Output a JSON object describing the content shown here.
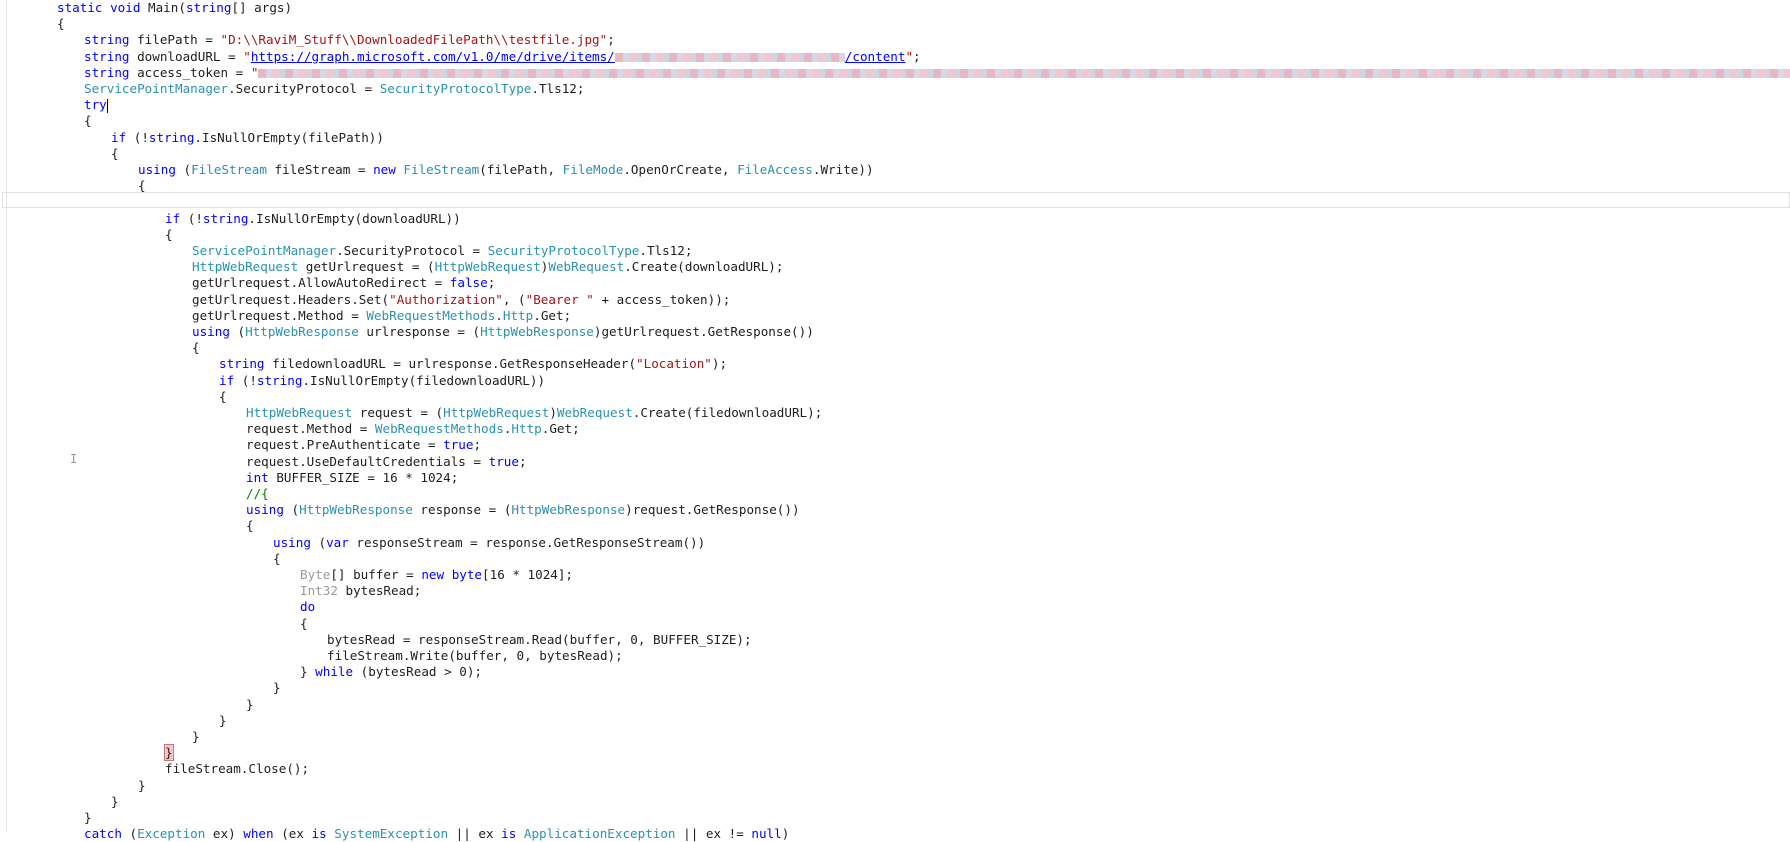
{
  "editor": {
    "lines": [
      {
        "indent": 0,
        "tokens": [
          {
            "c": "kw",
            "t": "static"
          },
          {
            "t": " "
          },
          {
            "c": "kw",
            "t": "void"
          },
          {
            "t": " Main("
          },
          {
            "c": "kw",
            "t": "string"
          },
          {
            "t": "[] args)"
          }
        ]
      },
      {
        "indent": 0,
        "tokens": [
          {
            "t": "{"
          }
        ]
      },
      {
        "indent": 1,
        "tokens": [
          {
            "c": "kw",
            "t": "string"
          },
          {
            "t": " filePath = "
          },
          {
            "c": "st",
            "t": "\"D:\\\\RaviM_Stuff\\\\DownloadedFilePath\\\\testfile.jpg\""
          },
          {
            "t": ";"
          }
        ]
      },
      {
        "indent": 1,
        "tokens": [
          {
            "c": "kw",
            "t": "string"
          },
          {
            "t": " downloadURL = "
          },
          {
            "c": "st",
            "t": "\""
          },
          {
            "c": "link",
            "t": "https://graph.microsoft.com/v1.0/me/drive/items/"
          },
          {
            "c": "blur",
            "w": 230
          },
          {
            "c": "link",
            "t": "/content"
          },
          {
            "c": "st",
            "t": "\""
          },
          {
            "t": ";"
          }
        ]
      },
      {
        "indent": 1,
        "tokens": [
          {
            "c": "kw",
            "t": "string"
          },
          {
            "t": " access_token = "
          },
          {
            "c": "st",
            "t": "\""
          },
          {
            "c": "blur",
            "w": 1545
          }
        ]
      },
      {
        "indent": 1,
        "tokens": [
          {
            "c": "ty",
            "t": "ServicePointManager"
          },
          {
            "t": ".SecurityProtocol = "
          },
          {
            "c": "ty",
            "t": "SecurityProtocolType"
          },
          {
            "t": ".Tls12;"
          }
        ]
      },
      {
        "indent": 1,
        "current": true,
        "tokens": [
          {
            "c": "kw",
            "t": "try"
          },
          {
            "c": "caret"
          }
        ]
      },
      {
        "indent": 1,
        "tokens": [
          {
            "t": "{"
          }
        ]
      },
      {
        "indent": 2,
        "tokens": [
          {
            "c": "kw",
            "t": "if"
          },
          {
            "t": " (!"
          },
          {
            "c": "kw",
            "t": "string"
          },
          {
            "t": ".IsNullOrEmpty(filePath))"
          }
        ]
      },
      {
        "indent": 2,
        "tokens": [
          {
            "t": "{"
          }
        ]
      },
      {
        "indent": 3,
        "tokens": [
          {
            "c": "kw",
            "t": "using"
          },
          {
            "t": " ("
          },
          {
            "c": "ty",
            "t": "FileStream"
          },
          {
            "t": " fileStream = "
          },
          {
            "c": "kw",
            "t": "new"
          },
          {
            "t": " "
          },
          {
            "c": "ty",
            "t": "FileStream"
          },
          {
            "t": "(filePath, "
          },
          {
            "c": "ty",
            "t": "FileMode"
          },
          {
            "t": ".OpenOrCreate, "
          },
          {
            "c": "ty",
            "t": "FileAccess"
          },
          {
            "t": ".Write))"
          }
        ]
      },
      {
        "indent": 3,
        "tokens": [
          {
            "t": "{"
          }
        ]
      },
      {
        "indent": 0,
        "tokens": []
      },
      {
        "indent": 4,
        "tokens": [
          {
            "c": "kw",
            "t": "if"
          },
          {
            "t": " (!"
          },
          {
            "c": "kw",
            "t": "string"
          },
          {
            "t": ".IsNullOrEmpty(downloadURL))"
          }
        ]
      },
      {
        "indent": 4,
        "tokens": [
          {
            "t": "{"
          }
        ]
      },
      {
        "indent": 5,
        "tokens": [
          {
            "c": "ty",
            "t": "ServicePointManager"
          },
          {
            "t": ".SecurityProtocol = "
          },
          {
            "c": "ty",
            "t": "SecurityProtocolType"
          },
          {
            "t": ".Tls12;"
          }
        ]
      },
      {
        "indent": 5,
        "tokens": [
          {
            "c": "ty",
            "t": "HttpWebRequest"
          },
          {
            "t": " getUrlrequest = ("
          },
          {
            "c": "ty",
            "t": "HttpWebRequest"
          },
          {
            "t": ")"
          },
          {
            "c": "ty",
            "t": "WebRequest"
          },
          {
            "t": ".Create(downloadURL);"
          }
        ]
      },
      {
        "indent": 5,
        "tokens": [
          {
            "t": "getUrlrequest.AllowAutoRedirect = "
          },
          {
            "c": "kw",
            "t": "false"
          },
          {
            "t": ";"
          }
        ]
      },
      {
        "indent": 5,
        "tokens": [
          {
            "t": "getUrlrequest.Headers.Set("
          },
          {
            "c": "st",
            "t": "\"Authorization\""
          },
          {
            "t": ", ("
          },
          {
            "c": "st",
            "t": "\"Bearer \""
          },
          {
            "t": " + access_token));"
          }
        ]
      },
      {
        "indent": 5,
        "tokens": [
          {
            "t": "getUrlrequest.Method = "
          },
          {
            "c": "ty",
            "t": "WebRequestMethods"
          },
          {
            "t": "."
          },
          {
            "c": "ty",
            "t": "Http"
          },
          {
            "t": ".Get;"
          }
        ]
      },
      {
        "indent": 5,
        "tokens": [
          {
            "c": "kw",
            "t": "using"
          },
          {
            "t": " ("
          },
          {
            "c": "ty",
            "t": "HttpWebResponse"
          },
          {
            "t": " urlresponse = ("
          },
          {
            "c": "ty",
            "t": "HttpWebResponse"
          },
          {
            "t": ")getUrlrequest.GetResponse())"
          }
        ]
      },
      {
        "indent": 5,
        "tokens": [
          {
            "t": "{"
          }
        ]
      },
      {
        "indent": 6,
        "tokens": [
          {
            "c": "kw",
            "t": "string"
          },
          {
            "t": " filedownloadURL = urlresponse.GetResponseHeader("
          },
          {
            "c": "st",
            "t": "\"Location\""
          },
          {
            "t": ");"
          }
        ]
      },
      {
        "indent": 6,
        "tokens": [
          {
            "c": "kw",
            "t": "if"
          },
          {
            "t": " (!"
          },
          {
            "c": "kw",
            "t": "string"
          },
          {
            "t": ".IsNullOrEmpty(filedownloadURL))"
          }
        ]
      },
      {
        "indent": 6,
        "tokens": [
          {
            "t": "{"
          }
        ]
      },
      {
        "indent": 7,
        "tokens": [
          {
            "c": "ty",
            "t": "HttpWebRequest"
          },
          {
            "t": " request = ("
          },
          {
            "c": "ty",
            "t": "HttpWebRequest"
          },
          {
            "t": ")"
          },
          {
            "c": "ty",
            "t": "WebRequest"
          },
          {
            "t": ".Create(filedownloadURL);"
          }
        ]
      },
      {
        "indent": 7,
        "tokens": [
          {
            "t": "request.Method = "
          },
          {
            "c": "ty",
            "t": "WebRequestMethods"
          },
          {
            "t": "."
          },
          {
            "c": "ty",
            "t": "Http"
          },
          {
            "t": ".Get;"
          }
        ]
      },
      {
        "indent": 7,
        "tokens": [
          {
            "t": "request.PreAuthenticate = "
          },
          {
            "c": "kw",
            "t": "true"
          },
          {
            "t": ";"
          }
        ]
      },
      {
        "indent": 7,
        "tokens": [
          {
            "t": "request.UseDefaultCredentials = "
          },
          {
            "c": "kw",
            "t": "true"
          },
          {
            "t": ";"
          }
        ]
      },
      {
        "indent": 7,
        "tokens": [
          {
            "c": "kw",
            "t": "int"
          },
          {
            "t": " BUFFER_SIZE = 16 * 1024;"
          }
        ]
      },
      {
        "indent": 7,
        "tokens": [
          {
            "c": "cm",
            "t": "//{"
          }
        ]
      },
      {
        "indent": 7,
        "tokens": [
          {
            "c": "kw",
            "t": "using"
          },
          {
            "t": " ("
          },
          {
            "c": "ty",
            "t": "HttpWebResponse"
          },
          {
            "t": " response = ("
          },
          {
            "c": "ty",
            "t": "HttpWebResponse"
          },
          {
            "t": ")request.GetResponse())"
          }
        ]
      },
      {
        "indent": 7,
        "tokens": [
          {
            "t": "{"
          }
        ]
      },
      {
        "indent": 8,
        "tokens": [
          {
            "c": "kw",
            "t": "using"
          },
          {
            "t": " ("
          },
          {
            "c": "kw",
            "t": "var"
          },
          {
            "t": " responseStream = response.GetResponseStream())"
          }
        ]
      },
      {
        "indent": 8,
        "tokens": [
          {
            "t": "{"
          }
        ]
      },
      {
        "indent": 9,
        "tokens": [
          {
            "c": "gr",
            "t": "Byte"
          },
          {
            "t": "[] buffer = "
          },
          {
            "c": "kw",
            "t": "new"
          },
          {
            "t": " "
          },
          {
            "c": "kw",
            "t": "byte"
          },
          {
            "t": "[16 * 1024];"
          }
        ]
      },
      {
        "indent": 9,
        "tokens": [
          {
            "c": "gr",
            "t": "Int32"
          },
          {
            "t": " bytesRead;"
          }
        ]
      },
      {
        "indent": 9,
        "tokens": [
          {
            "c": "kw",
            "t": "do"
          }
        ]
      },
      {
        "indent": 9,
        "tokens": [
          {
            "t": "{"
          }
        ]
      },
      {
        "indent": 10,
        "tokens": [
          {
            "t": "bytesRead = responseStream.Read(buffer, 0, BUFFER_SIZE);"
          }
        ]
      },
      {
        "indent": 10,
        "tokens": [
          {
            "t": "fileStream.Write(buffer, 0, bytesRead);"
          }
        ]
      },
      {
        "indent": 9,
        "tokens": [
          {
            "t": "} "
          },
          {
            "c": "kw",
            "t": "while"
          },
          {
            "t": " (bytesRead > 0);"
          }
        ]
      },
      {
        "indent": 8,
        "tokens": [
          {
            "t": "}"
          }
        ]
      },
      {
        "indent": 7,
        "tokens": [
          {
            "t": "}"
          }
        ]
      },
      {
        "indent": 6,
        "tokens": [
          {
            "t": "}"
          }
        ]
      },
      {
        "indent": 5,
        "tokens": [
          {
            "t": "}"
          }
        ]
      },
      {
        "indent": 4,
        "tokens": [
          {
            "c": "brace-hl",
            "t": "}"
          }
        ]
      },
      {
        "indent": 4,
        "tokens": [
          {
            "t": "fileStream.Close();"
          }
        ]
      },
      {
        "indent": 3,
        "tokens": [
          {
            "t": "}"
          }
        ]
      },
      {
        "indent": 2,
        "tokens": [
          {
            "t": "}"
          }
        ]
      },
      {
        "indent": 1,
        "tokens": [
          {
            "t": "}"
          }
        ]
      },
      {
        "indent": 1,
        "tokens": [
          {
            "c": "kw",
            "t": "catch"
          },
          {
            "t": " ("
          },
          {
            "c": "ty",
            "t": "Exception"
          },
          {
            "t": " ex) "
          },
          {
            "c": "kw",
            "t": "when"
          },
          {
            "t": " (ex "
          },
          {
            "c": "kw",
            "t": "is"
          },
          {
            "t": " "
          },
          {
            "c": "ty",
            "t": "SystemException"
          },
          {
            "t": " || ex "
          },
          {
            "c": "kw",
            "t": "is"
          },
          {
            "t": " "
          },
          {
            "c": "ty",
            "t": "ApplicationException"
          },
          {
            "t": " || ex != "
          },
          {
            "c": "kw",
            "t": "null"
          },
          {
            "t": ")"
          }
        ]
      }
    ]
  }
}
